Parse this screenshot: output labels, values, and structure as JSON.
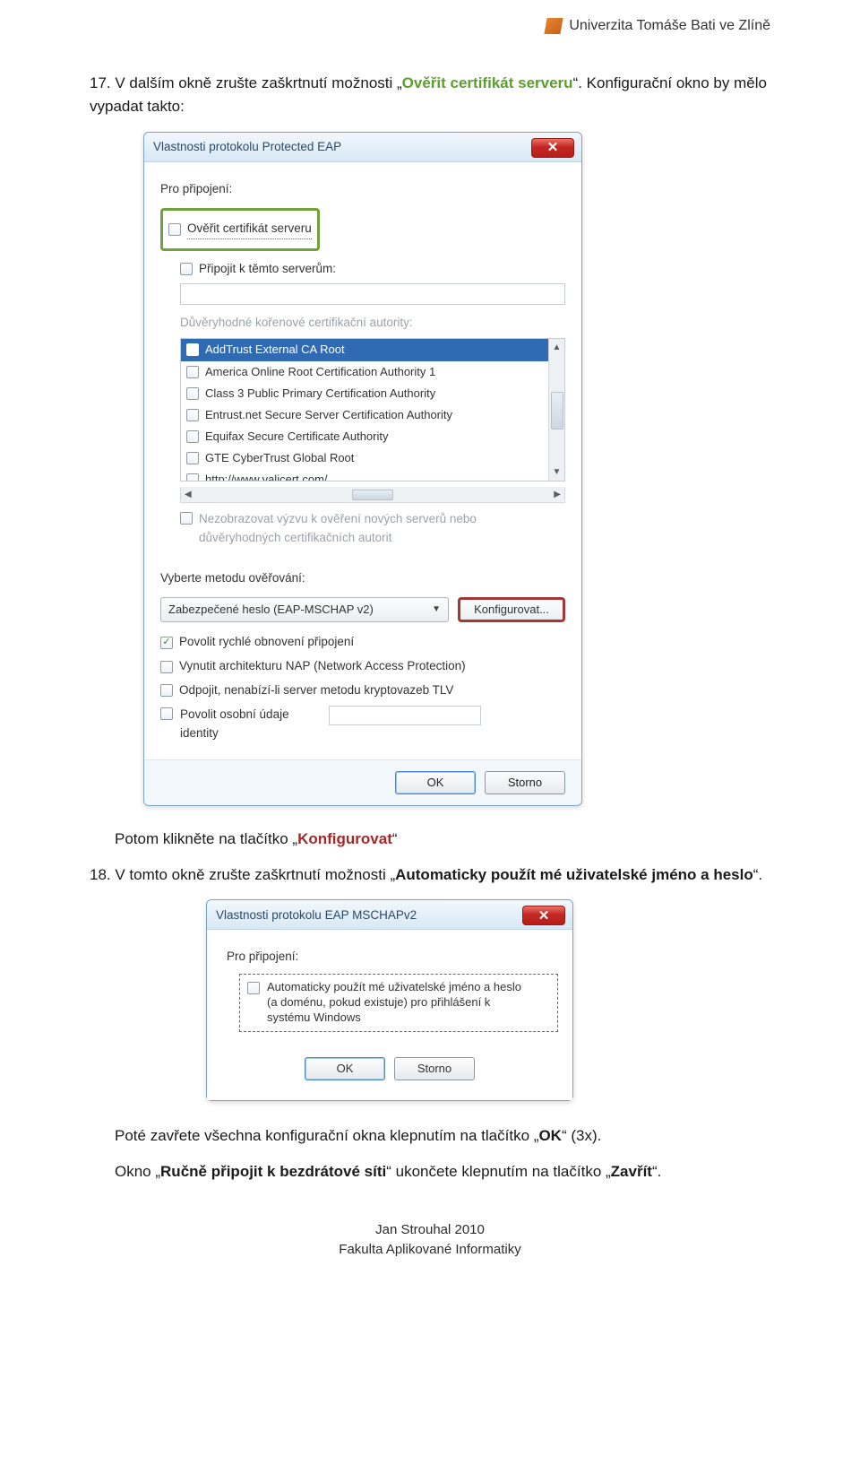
{
  "header": {
    "university": "Univerzita Tomáše Bati ve Zlíně"
  },
  "step17": {
    "num": "17.",
    "text_a": "V dalším okně zrušte zaškrtnutí možnosti „",
    "green": "Ověřit certifikát serveru",
    "text_b": "“. Konfigurační okno by mělo vypadat takto:"
  },
  "dlg1": {
    "title": "Vlastnosti protokolu Protected EAP",
    "for": "Pro připojení:",
    "verify": "Ověřit certifikát serveru",
    "connect": "Připojit k těmto serverům:",
    "trustedLabel": "Důvěryhodné kořenové certifikační autority:",
    "ca": [
      "AddTrust External CA Root",
      "America Online Root Certification Authority 1",
      "Class 3 Public Primary Certification Authority",
      "Entrust.net Secure Server Certification Authority",
      "Equifax Secure Certificate Authority",
      "GTE CyberTrust Global Root",
      "http://www.valicert.com/"
    ],
    "noprompt": "Nezobrazovat výzvu k ověření nových serverů nebo důvěryhodných certifikačních autorit",
    "authLabel": "Vyberte metodu ověřování:",
    "authValue": "Zabezpečené heslo (EAP-MSCHAP v2)",
    "config": "Konfigurovat...",
    "fast": "Povolit rychlé obnovení připojení",
    "nap": "Vynutit architekturu NAP (Network Access Protection)",
    "tlv": "Odpojit, nenabízí-li server metodu kryptovazeb TLV",
    "identity": "Povolit osobní údaje identity",
    "ok": "OK",
    "cancel": "Storno"
  },
  "afterDlg1": {
    "line_a": "Potom klikněte na tlačítko „",
    "red": "Konfigurovat",
    "line_b": "“"
  },
  "step18": {
    "num": "18.",
    "text_a": "V tomto okně zrušte zaškrtnutí možnosti „",
    "bold": "Automaticky použít mé uživatelské jméno a heslo",
    "text_b": "“."
  },
  "dlg2": {
    "title": "Vlastnosti protokolu EAP MSCHAPv2",
    "for": "Pro připojení:",
    "auto_l1": "Automaticky použít mé uživatelské jméno a heslo",
    "auto_l2": "(a doménu, pokud existuje) pro přihlášení k",
    "auto_l3": "systému Windows",
    "ok": "OK",
    "cancel": "Storno"
  },
  "closing": {
    "l1a": "Poté zavřete všechna konfigurační okna klepnutím na tlačítko „",
    "l1b": "OK",
    "l1c": "“ (3x).",
    "l2a": "Okno „",
    "l2b": "Ručně připojit k bezdrátové síti",
    "l2c": "“ ukončete klepnutím na tlačítko „",
    "l2d": "Zavřít",
    "l2e": "“."
  },
  "footer": {
    "author": "Jan Strouhal 2010",
    "faculty": "Fakulta Aplikované Informatiky"
  }
}
